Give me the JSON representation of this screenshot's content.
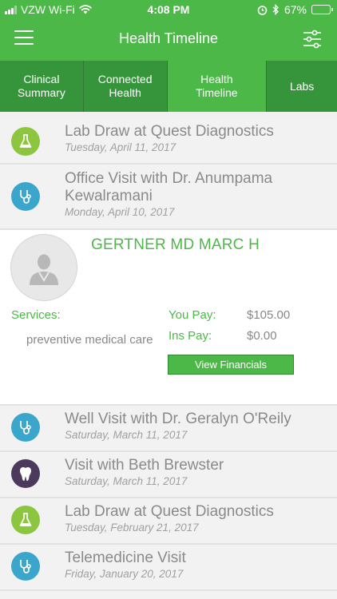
{
  "status_bar": {
    "carrier": "VZW Wi-Fi",
    "time": "4:08 PM",
    "battery": "67%",
    "battery_level": 0.67
  },
  "header": {
    "title": "Health Timeline"
  },
  "tabs": [
    {
      "label": "Clinical Summary",
      "active": false
    },
    {
      "label": "Connected Health",
      "active": false
    },
    {
      "label": "Health Timeline",
      "active": true
    },
    {
      "label": "Labs",
      "active": false
    }
  ],
  "events": [
    {
      "title": "Lab Draw at Quest Diagnostics",
      "date": "Tuesday, April 11, 2017",
      "icon": "flask-icon"
    },
    {
      "title": "Office Visit with Dr. Anumpama Kewalramani",
      "date": "Monday, April 10, 2017",
      "icon": "stethoscope-icon"
    },
    {
      "title": "Well Visit with Dr. Geralyn O'Reily",
      "date": "Saturday, March 11, 2017",
      "icon": "stethoscope-icon"
    },
    {
      "title": "Visit with Beth Brewster",
      "date": "Saturday, March 11, 2017",
      "icon": "tooth-icon"
    },
    {
      "title": "Lab Draw at Quest Diagnostics",
      "date": "Tuesday, February 21, 2017",
      "icon": "flask-icon"
    },
    {
      "title": "Telemedicine Visit",
      "date": "Friday, January 20, 2017",
      "icon": "stethoscope-icon"
    }
  ],
  "detail": {
    "provider": "GERTNER MD MARC H",
    "services_label": "Services:",
    "service": "preventive medical care",
    "you_pay_label": "You Pay:",
    "you_pay": "$105.00",
    "ins_pay_label": "Ins Pay:",
    "ins_pay": "$0.00",
    "button_label": "View Financials"
  },
  "colors": {
    "brand_green": "#4cb848",
    "tab_dark": "#36953a",
    "lab_icon": "#8cc63f",
    "visit_icon": "#3aa6cc",
    "dental_icon": "#4b3a5c"
  }
}
